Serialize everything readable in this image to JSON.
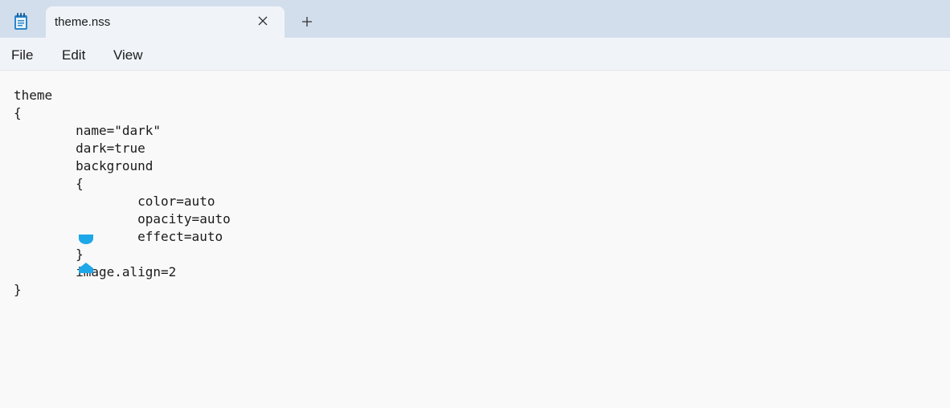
{
  "window": {
    "tab_title": "theme.nss",
    "app_icon": "notepad-icon",
    "close_icon": "close-icon",
    "new_tab_icon": "plus-icon"
  },
  "menu": {
    "file": "File",
    "edit": "Edit",
    "view": "View"
  },
  "editor": {
    "lines": [
      "theme",
      "{",
      "\tname=\"dark\"",
      "\tdark=true",
      "\tbackground",
      "\t{",
      "\t\tcolor=auto",
      "\t\topacity=auto",
      "\t\teffect=auto",
      "\t}",
      "\timage.align=2",
      "}"
    ]
  },
  "colors": {
    "titlebar": "#d3deec",
    "tab": "#f0f4f9",
    "editor_bg": "#f9f9f9",
    "selection_handle": "#1ea7e9"
  }
}
